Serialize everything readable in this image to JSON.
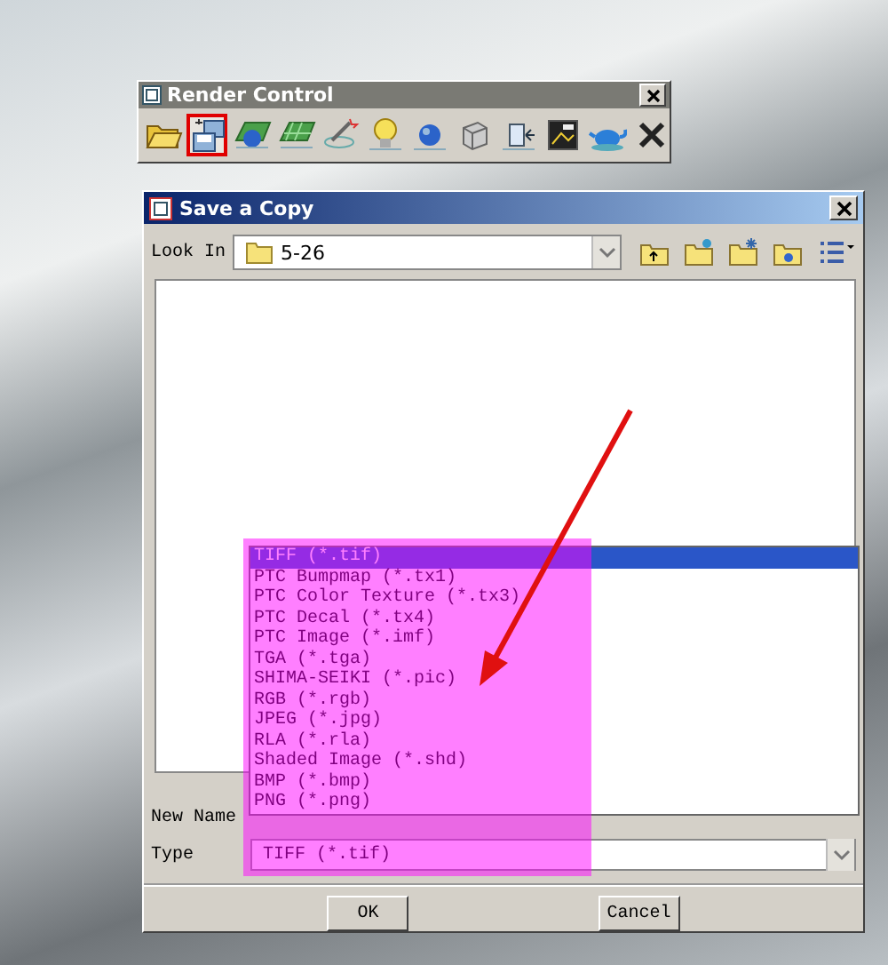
{
  "toolbar_window": {
    "title": "Render Control",
    "tools": [
      {
        "kind": "open",
        "highlighted": false
      },
      {
        "kind": "save-copy",
        "highlighted": true
      },
      {
        "kind": "globe-grid",
        "highlighted": false
      },
      {
        "kind": "grid",
        "highlighted": false
      },
      {
        "kind": "wand",
        "highlighted": false
      },
      {
        "kind": "bulb",
        "highlighted": false
      },
      {
        "kind": "sphere",
        "highlighted": false
      },
      {
        "kind": "cube",
        "highlighted": false
      },
      {
        "kind": "import",
        "highlighted": false
      },
      {
        "kind": "picture",
        "highlighted": false
      },
      {
        "kind": "teapot",
        "highlighted": false
      },
      {
        "kind": "close",
        "highlighted": false
      }
    ]
  },
  "dialog": {
    "title": "Save a Copy",
    "look_in": {
      "label": "Look In",
      "value": "5-26"
    },
    "file_type_list": [
      {
        "label": "TIFF (*.tif)",
        "selected": true
      },
      {
        "label": "PTC Bumpmap (*.tx1)",
        "selected": false
      },
      {
        "label": "PTC Color Texture (*.tx3)",
        "selected": false
      },
      {
        "label": "PTC Decal (*.tx4)",
        "selected": false
      },
      {
        "label": "PTC Image (*.imf)",
        "selected": false
      },
      {
        "label": "TGA (*.tga)",
        "selected": false
      },
      {
        "label": "SHIMA-SEIKI (*.pic)",
        "selected": false
      },
      {
        "label": "RGB (*.rgb)",
        "selected": false
      },
      {
        "label": "JPEG (*.jpg)",
        "selected": false
      },
      {
        "label": "RLA (*.rla)",
        "selected": false
      },
      {
        "label": "Shaded Image (*.shd)",
        "selected": false
      },
      {
        "label": "BMP (*.bmp)",
        "selected": false
      },
      {
        "label": "PNG (*.png)",
        "selected": false
      }
    ],
    "new_name": {
      "label": "New Name"
    },
    "type": {
      "label": "Type",
      "value": "TIFF (*.tif)"
    },
    "buttons": [
      "OK",
      "Cancel"
    ]
  }
}
